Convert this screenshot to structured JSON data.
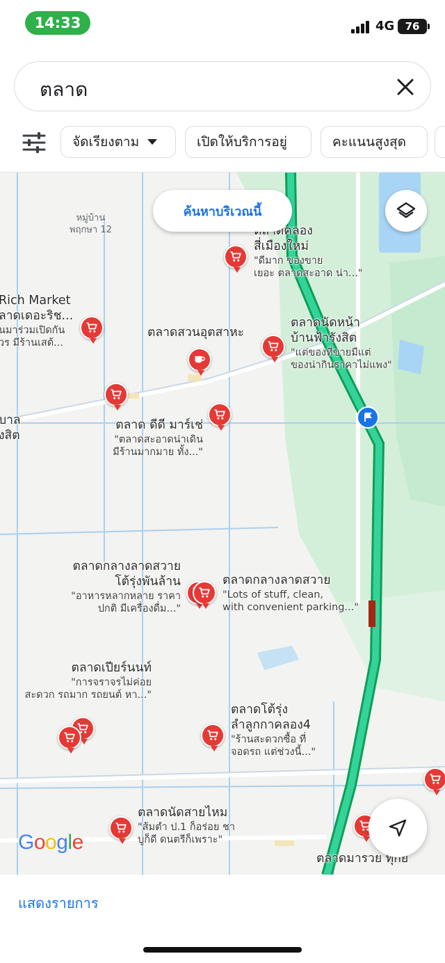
{
  "status": {
    "time": "14:33",
    "network": "4G",
    "battery": "76"
  },
  "search": {
    "query": "ตลาด"
  },
  "chips": [
    "จัดเรียงตาม",
    "เปิดให้บริการอยู่",
    "คะแนนสูงสุด"
  ],
  "map": {
    "search_area_label": "ค้นหาบริเวณนี้",
    "area_label": "หมู่บ้าน\nพฤกษา 12",
    "places": [
      {
        "name": "ตลาดคลอง\nสี่เมืองใหม่",
        "review": "\"ดีมาก ของขาย\nเยอะ ตลาดสะอาด น่า...\""
      },
      {
        "name": "Rich Market\nลาดเดอะริช...",
        "review": "นมาร่วมเปิดกัน\nวร มีร้านเสต้..."
      },
      {
        "name": "ตลาดสวนอุตสาหะ",
        "review": ""
      },
      {
        "name": "ตลาดนัดหน้า\nบ้านฟ้ารังสิต",
        "review": "\"แต่ของที่ขายมีแต่\nของน่ากินราคาไม่แพง\""
      },
      {
        "name": "บาล\nงสิต",
        "review": ""
      },
      {
        "name": "ตลาด ดีดี มาร์เช่",
        "review": "\"ตลาดสะอาดน่าเดิน\nมีร้านมากมาย ทั้ง...\""
      },
      {
        "name": "ตลาดกลางลาดสวาย\nโต้รุ่งพันล้าน",
        "review": "\"อาหารหลากหลาย ราคา\nปกติ มีเครื่องดื่ม...\""
      },
      {
        "name": "ตลาดกลางลาดสวาย",
        "review": "\"Lots of stuff, clean,\nwith convenient parking...\""
      },
      {
        "name": "ตลาดเปียร์นนท์",
        "review": "\"การจราจรไม่ค่อย\nสะดวก รถมาก รถยนต์ หา...\""
      },
      {
        "name": "ตลาดโต้รุ่ง\nลำลูกกาคลอง4",
        "review": "\"ร้านสะดวกซื้อ ที่\nจอดรถ แต่ช่วงนี้...\""
      },
      {
        "name": "ตลาดนัดสายไหม",
        "review": "\"ส้มตำ ป.1 ก็อร่อย ชา\nบูก็ดี ดนตรีก็เพราะ\""
      },
      {
        "name": "ตลาดมารวย ทุกย",
        "review": ""
      }
    ],
    "logo": "Google",
    "colors": {
      "highway": "#1fc97f",
      "highway_edge": "#0f9d58",
      "pin": "#e53935",
      "accent": "#1a73e8",
      "park": "#cdeed3",
      "water": "#a8d4f5"
    }
  },
  "sheet": {
    "show_list": "แสดงรายการ"
  }
}
